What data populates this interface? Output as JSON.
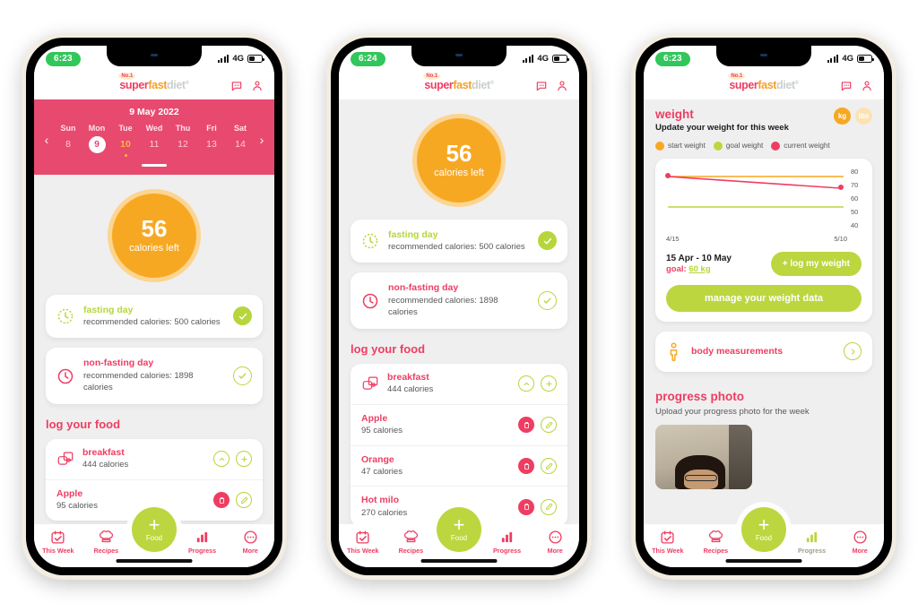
{
  "brand": {
    "logo_badge": "No.1",
    "logo_part1": "super",
    "logo_part2": "fast",
    "logo_part3": "diet",
    "logo_tm": "®",
    "pink": "#ef3d62",
    "orange": "#f7a823",
    "green": "#bcd63f",
    "calendar_pink": "#e8496f"
  },
  "phones": [
    {
      "status": {
        "time": "6:23",
        "network": "4G"
      },
      "calendar": {
        "title": "9 May 2022",
        "prev": "‹",
        "next": "›",
        "days": [
          {
            "dow": "Sun",
            "num": "8",
            "state": "normal",
            "dot": false
          },
          {
            "dow": "Mon",
            "num": "9",
            "state": "selected",
            "dot": false
          },
          {
            "dow": "Tue",
            "num": "10",
            "state": "today",
            "dot": true
          },
          {
            "dow": "Wed",
            "num": "11",
            "state": "normal",
            "dot": false
          },
          {
            "dow": "Thu",
            "num": "12",
            "state": "normal",
            "dot": false
          },
          {
            "dow": "Fri",
            "num": "13",
            "state": "normal",
            "dot": false
          },
          {
            "dow": "Sat",
            "num": "14",
            "state": "normal",
            "dot": false
          }
        ]
      },
      "calories": {
        "value": "56",
        "label": "calories left"
      },
      "day_cards": [
        {
          "title": "fasting day",
          "sub": "recommended calories: 500 calories",
          "tone": "green",
          "check": "filled"
        },
        {
          "title": "non-fasting day",
          "sub": "recommended calories: 1898 calories",
          "tone": "pink",
          "check": "outline"
        }
      ],
      "log_section_title": "log your food",
      "food_rows": [
        {
          "name": "breakfast",
          "cals": "444 calories",
          "type": "meal"
        },
        {
          "name": "Apple",
          "cals": "95 calories",
          "type": "item"
        }
      ],
      "tabs": [
        {
          "label": "This Week",
          "icon": "calendar-check-icon",
          "active": false
        },
        {
          "label": "Recipes",
          "icon": "chef-hat-icon",
          "active": false
        },
        {
          "label": "Food",
          "icon": "plus-icon",
          "active": true
        },
        {
          "label": "Progress",
          "icon": "bar-chart-icon",
          "active": false
        },
        {
          "label": "More",
          "icon": "ellipsis-icon",
          "active": false
        }
      ],
      "fab": {
        "label": "Food",
        "plus": "+"
      }
    },
    {
      "status": {
        "time": "6:24",
        "network": "4G"
      },
      "calories": {
        "value": "56",
        "label": "calories left"
      },
      "day_cards": [
        {
          "title": "fasting day",
          "sub": "recommended calories: 500 calories",
          "tone": "green",
          "check": "filled"
        },
        {
          "title": "non-fasting day",
          "sub": "recommended calories: 1898 calories",
          "tone": "pink",
          "check": "outline"
        }
      ],
      "log_section_title": "log your food",
      "food_rows": [
        {
          "name": "breakfast",
          "cals": "444 calories",
          "type": "meal"
        },
        {
          "name": "Apple",
          "cals": "95 calories",
          "type": "item"
        },
        {
          "name": "Orange",
          "cals": "47 calories",
          "type": "item"
        },
        {
          "name": "Hot milo",
          "cals": "270 calories",
          "type": "item"
        }
      ],
      "tabs": [
        {
          "label": "This Week",
          "icon": "calendar-check-icon",
          "active": false
        },
        {
          "label": "Recipes",
          "icon": "chef-hat-icon",
          "active": false
        },
        {
          "label": "Food",
          "icon": "plus-icon",
          "active": true
        },
        {
          "label": "Progress",
          "icon": "bar-chart-icon",
          "active": false
        },
        {
          "label": "More",
          "icon": "ellipsis-icon",
          "active": false
        }
      ],
      "fab": {
        "label": "Food",
        "plus": "+"
      }
    },
    {
      "status": {
        "time": "6:23",
        "network": "4G"
      },
      "weight": {
        "title": "weight",
        "subtitle": "Update your weight for this week",
        "units": [
          {
            "label": "kg",
            "selected": true
          },
          {
            "label": "lbs",
            "selected": false
          }
        ],
        "legend": [
          {
            "label": "start weight",
            "color": "#f7a823"
          },
          {
            "label": "goal weight",
            "color": "#bcd63f"
          },
          {
            "label": "current weight",
            "color": "#ef3d62"
          }
        ],
        "range_date": "15 Apr - 10 May",
        "goal_label": "goal:",
        "goal_value": "60 kg",
        "log_button": "+ log my weight",
        "manage_button": "manage your weight data"
      },
      "measurements": {
        "label": "body measurements",
        "chevron": "›"
      },
      "progress_photo": {
        "title": "progress photo",
        "subtitle": "Upload your progress photo for the week"
      },
      "tabs": [
        {
          "label": "This Week",
          "icon": "calendar-check-icon",
          "active": false
        },
        {
          "label": "Recipes",
          "icon": "chef-hat-icon",
          "active": false
        },
        {
          "label": "Food",
          "icon": "plus-icon",
          "active": true
        },
        {
          "label": "Progress",
          "icon": "bar-chart-icon",
          "active": true
        },
        {
          "label": "More",
          "icon": "ellipsis-icon",
          "active": false
        }
      ],
      "fab": {
        "label": "Food",
        "plus": "+"
      }
    }
  ],
  "chart_data": {
    "type": "line",
    "title": "weight",
    "xlabel": "",
    "ylabel": "",
    "x": [
      "4/15",
      "5/10"
    ],
    "xticks": [
      "4/15",
      "5/10"
    ],
    "yticks": [
      80,
      70,
      60,
      50,
      40
    ],
    "ylim": [
      35,
      85
    ],
    "grid": false,
    "legend_position": "above",
    "series": [
      {
        "name": "start weight",
        "color": "#f7a823",
        "values": [
          80,
          80
        ]
      },
      {
        "name": "goal weight",
        "color": "#bcd63f",
        "values": [
          60,
          60
        ]
      },
      {
        "name": "current weight",
        "color": "#ef3d62",
        "values": [
          80,
          75
        ]
      }
    ]
  }
}
